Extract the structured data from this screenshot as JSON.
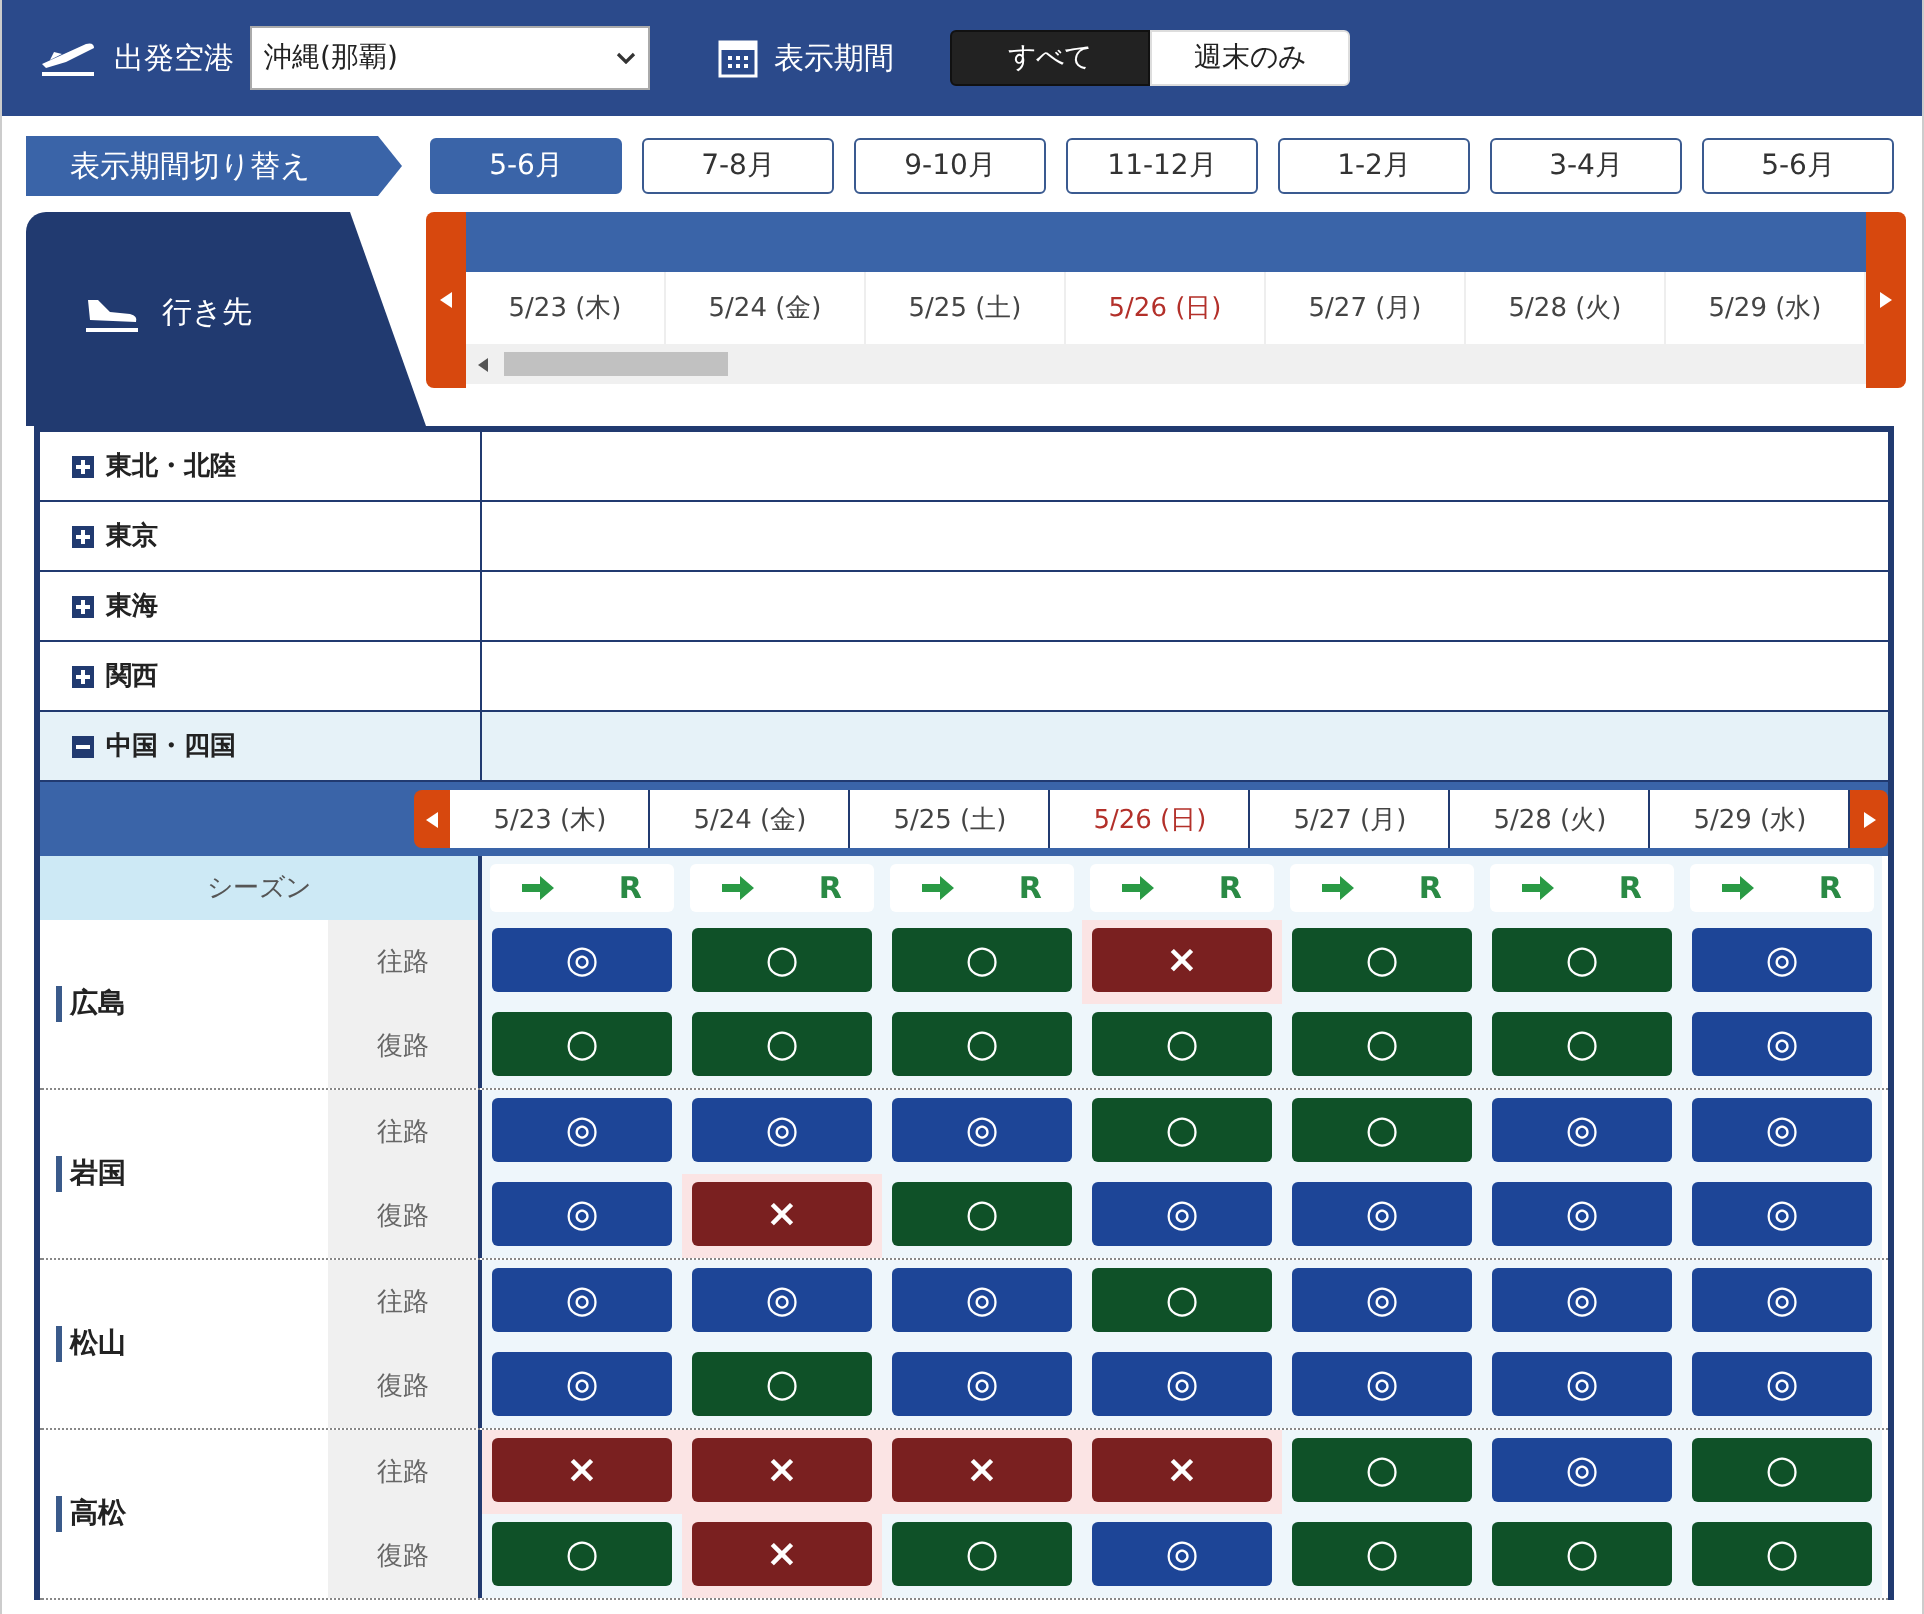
{
  "header": {
    "departure_label": "出発空港",
    "departure_value": "沖縄(那覇)",
    "period_label": "表示期間",
    "period_options": [
      {
        "label": "すべて",
        "selected": true
      },
      {
        "label": "週末のみ",
        "selected": false
      }
    ]
  },
  "period_switch": {
    "label": "表示期間切り替え",
    "options": [
      {
        "label": "5-6月",
        "selected": true
      },
      {
        "label": "7-8月",
        "selected": false
      },
      {
        "label": "9-10月",
        "selected": false
      },
      {
        "label": "11-12月",
        "selected": false
      },
      {
        "label": "1-2月",
        "selected": false
      },
      {
        "label": "3-4月",
        "selected": false
      },
      {
        "label": "5-6月",
        "selected": false
      }
    ]
  },
  "destination": {
    "label": "行き先",
    "dates": [
      {
        "label": "5/23 (木)",
        "holiday": false
      },
      {
        "label": "5/24 (金)",
        "holiday": false
      },
      {
        "label": "5/25 (土)",
        "holiday": false
      },
      {
        "label": "5/26 (日)",
        "holiday": true
      },
      {
        "label": "5/27 (月)",
        "holiday": false
      },
      {
        "label": "5/28 (火)",
        "holiday": false
      },
      {
        "label": "5/29 (水)",
        "holiday": false
      }
    ]
  },
  "regions": [
    {
      "label": "東北・北陸",
      "expanded": false
    },
    {
      "label": "東京",
      "expanded": false
    },
    {
      "label": "東海",
      "expanded": false
    },
    {
      "label": "関西",
      "expanded": false
    },
    {
      "label": "中国・四国",
      "expanded": true
    }
  ],
  "schedule": {
    "season_label": "シーズン",
    "dates": [
      {
        "label": "5/23 (木)",
        "holiday": false,
        "mark": "R"
      },
      {
        "label": "5/24 (金)",
        "holiday": false,
        "mark": "R"
      },
      {
        "label": "5/25 (土)",
        "holiday": false,
        "mark": "R"
      },
      {
        "label": "5/26 (日)",
        "holiday": true,
        "mark": "R"
      },
      {
        "label": "5/27 (月)",
        "holiday": false,
        "mark": "R"
      },
      {
        "label": "5/28 (火)",
        "holiday": false,
        "mark": "R"
      },
      {
        "label": "5/29 (水)",
        "holiday": false,
        "mark": "R"
      }
    ],
    "airports": [
      {
        "name": "広島",
        "legs": [
          {
            "label": "往路",
            "cells": [
              {
                "kind": "double",
                "text": "◎"
              },
              {
                "kind": "single",
                "text": "○"
              },
              {
                "kind": "single",
                "text": "○"
              },
              {
                "kind": "none",
                "text": "×"
              },
              {
                "kind": "single",
                "text": "○"
              },
              {
                "kind": "single",
                "text": "○"
              },
              {
                "kind": "double",
                "text": "◎"
              }
            ]
          },
          {
            "label": "復路",
            "cells": [
              {
                "kind": "single",
                "text": "○"
              },
              {
                "kind": "single",
                "text": "○"
              },
              {
                "kind": "single",
                "text": "○"
              },
              {
                "kind": "single",
                "text": "○"
              },
              {
                "kind": "single",
                "text": "○"
              },
              {
                "kind": "single",
                "text": "○"
              },
              {
                "kind": "double",
                "text": "◎"
              }
            ]
          }
        ]
      },
      {
        "name": "岩国",
        "legs": [
          {
            "label": "往路",
            "cells": [
              {
                "kind": "double",
                "text": "◎"
              },
              {
                "kind": "double",
                "text": "◎"
              },
              {
                "kind": "double",
                "text": "◎"
              },
              {
                "kind": "single",
                "text": "○"
              },
              {
                "kind": "single",
                "text": "○"
              },
              {
                "kind": "double",
                "text": "◎"
              },
              {
                "kind": "double",
                "text": "◎"
              }
            ]
          },
          {
            "label": "復路",
            "cells": [
              {
                "kind": "double",
                "text": "◎"
              },
              {
                "kind": "none",
                "text": "×"
              },
              {
                "kind": "single",
                "text": "○"
              },
              {
                "kind": "double",
                "text": "◎"
              },
              {
                "kind": "double",
                "text": "◎"
              },
              {
                "kind": "double",
                "text": "◎"
              },
              {
                "kind": "double",
                "text": "◎"
              }
            ]
          }
        ]
      },
      {
        "name": "松山",
        "legs": [
          {
            "label": "往路",
            "cells": [
              {
                "kind": "double",
                "text": "◎"
              },
              {
                "kind": "double",
                "text": "◎"
              },
              {
                "kind": "double",
                "text": "◎"
              },
              {
                "kind": "single",
                "text": "○"
              },
              {
                "kind": "double",
                "text": "◎"
              },
              {
                "kind": "double",
                "text": "◎"
              },
              {
                "kind": "double",
                "text": "◎"
              }
            ]
          },
          {
            "label": "復路",
            "cells": [
              {
                "kind": "double",
                "text": "◎"
              },
              {
                "kind": "single",
                "text": "○"
              },
              {
                "kind": "double",
                "text": "◎"
              },
              {
                "kind": "double",
                "text": "◎"
              },
              {
                "kind": "double",
                "text": "◎"
              },
              {
                "kind": "double",
                "text": "◎"
              },
              {
                "kind": "double",
                "text": "◎"
              }
            ]
          }
        ]
      },
      {
        "name": "高松",
        "legs": [
          {
            "label": "往路",
            "cells": [
              {
                "kind": "none",
                "text": "×"
              },
              {
                "kind": "none",
                "text": "×"
              },
              {
                "kind": "none",
                "text": "×"
              },
              {
                "kind": "none",
                "text": "×"
              },
              {
                "kind": "single",
                "text": "○"
              },
              {
                "kind": "double",
                "text": "◎"
              },
              {
                "kind": "single",
                "text": "○"
              }
            ]
          },
          {
            "label": "復路",
            "cells": [
              {
                "kind": "single",
                "text": "○"
              },
              {
                "kind": "none",
                "text": "×"
              },
              {
                "kind": "single",
                "text": "○"
              },
              {
                "kind": "double",
                "text": "◎"
              },
              {
                "kind": "single",
                "text": "○"
              },
              {
                "kind": "single",
                "text": "○"
              },
              {
                "kind": "single",
                "text": "○"
              }
            ]
          }
        ]
      }
    ]
  }
}
